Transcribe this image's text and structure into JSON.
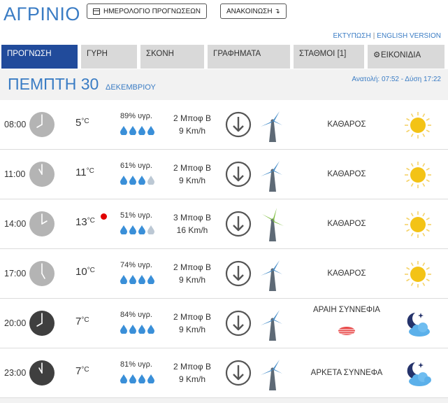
{
  "header": {
    "city": "ΑΓΡΙΝΙΟ",
    "calendar_button": "ΗΜΕΡΟΛΟΓΙΟ ΠΡΟΓΝΩΣΕΩΝ",
    "announce_button": "ΑΝΑΚΟΙΝΩΣΗ ↴",
    "print_link": "ΕΚΤΥΠΩΣΗ",
    "separator": "|",
    "english_link": "ENGLISH VERSION"
  },
  "tabs": [
    {
      "label": "ΠΡΟΓΝΩΣΗ",
      "active": true
    },
    {
      "label": "ΓΥΡΗ",
      "active": false
    },
    {
      "label": "ΣΚΟΝΗ",
      "active": false
    },
    {
      "label": "ΓΡΑΦΗΜΑΤΑ",
      "active": false
    },
    {
      "label": "ΣΤΑΘΜΟΙ  [1]",
      "active": false
    },
    {
      "label": "ΕΙΚΟΝΙΔΙΑ",
      "active": false
    }
  ],
  "day": {
    "name": "ΠΕΜΠΤΗ 30",
    "month": "ΔΕΚΕΜΒΡΙΟΥ",
    "sun": "Ανατολή: 07:52  - Δύση 17:22"
  },
  "units": {
    "temp": "°C"
  },
  "colors": {
    "accent": "#3a7cc4",
    "active_tab": "#214b9b",
    "drop": "#3a8fd8",
    "sun": "#f3c316",
    "red_alert": "#e10000"
  },
  "rows": [
    {
      "time": "08:00",
      "hour": 8,
      "night": false,
      "temp": "5",
      "alert": false,
      "humidity": "89% υγρ.",
      "drops_full": 4,
      "wind_force": "2 Μποφ Β",
      "wind_speed": "9 Km/h",
      "turbine": "blue",
      "condition": "ΚΑΘΑΡΟΣ",
      "icon": "sun-icon"
    },
    {
      "time": "11:00",
      "hour": 11,
      "night": false,
      "temp": "11",
      "alert": false,
      "humidity": "61% υγρ.",
      "drops_full": 3,
      "wind_force": "2 Μποφ Β",
      "wind_speed": "9 Km/h",
      "turbine": "blue",
      "condition": "ΚΑΘΑΡΟΣ",
      "icon": "sun-icon"
    },
    {
      "time": "14:00",
      "hour": 2,
      "night": false,
      "temp": "13",
      "alert": true,
      "humidity": "51% υγρ.",
      "drops_full": 3,
      "wind_force": "3 Μποφ Β",
      "wind_speed": "16 Km/h",
      "turbine": "green",
      "condition": "ΚΑΘΑΡΟΣ",
      "icon": "sun-icon"
    },
    {
      "time": "17:00",
      "hour": 5,
      "night": false,
      "temp": "10",
      "alert": false,
      "humidity": "74% υγρ.",
      "drops_full": 4,
      "wind_force": "2 Μποφ Β",
      "wind_speed": "9 Km/h",
      "turbine": "blue",
      "condition": "ΚΑΘΑΡΟΣ",
      "icon": "sun-icon"
    },
    {
      "time": "20:00",
      "hour": 8,
      "night": true,
      "temp": "7",
      "alert": false,
      "humidity": "84% υγρ.",
      "drops_full": 4,
      "wind_force": "2 Μποφ Β",
      "wind_speed": "9 Km/h",
      "turbine": "blue",
      "condition": "ΑΡΑΙΗ ΣΥΝΝΕΦΙΑ",
      "icon": "moon-cloud-icon",
      "cloud_badge": true
    },
    {
      "time": "23:00",
      "hour": 11,
      "night": true,
      "temp": "7",
      "alert": false,
      "humidity": "81% υγρ.",
      "drops_full": 4,
      "wind_force": "2 Μποφ Β",
      "wind_speed": "9 Km/h",
      "turbine": "blue",
      "condition": "ΑΡΚΕΤΑ ΣΥΝΝΕΦΑ",
      "icon": "moon-cloud-icon",
      "cloud_badge": false
    }
  ]
}
